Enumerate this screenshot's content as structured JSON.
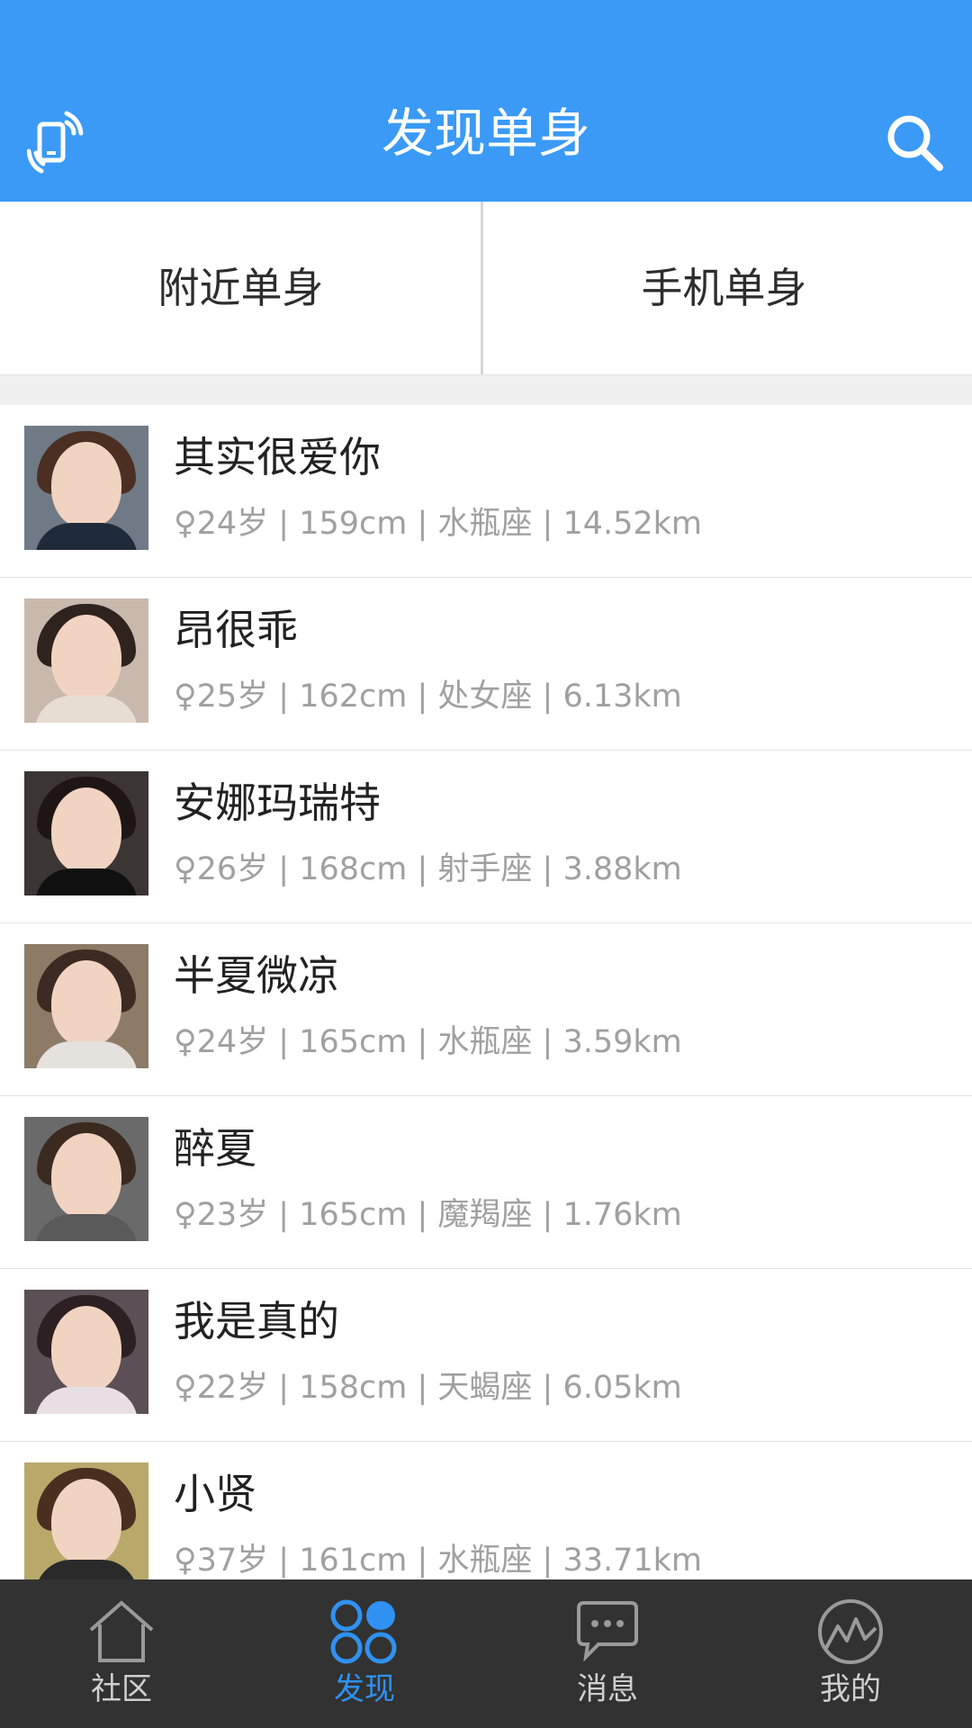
{
  "header": {
    "title": "发现单身",
    "left_icon": "phone-vibrate-icon",
    "right_icon": "search-icon",
    "color": "#3a9af6"
  },
  "segments": [
    {
      "label": "附近单身"
    },
    {
      "label": "手机单身"
    }
  ],
  "list": [
    {
      "name": "其实很爱你",
      "meta": "♀24岁 | 159cm | 水瓶座 | 14.52km"
    },
    {
      "name": "昂很乖",
      "meta": "♀25岁 | 162cm | 处女座 | 6.13km"
    },
    {
      "name": "安娜玛瑞特",
      "meta": "♀26岁 | 168cm | 射手座 | 3.88km"
    },
    {
      "name": "半夏微凉",
      "meta": "♀24岁 | 165cm | 水瓶座 | 3.59km"
    },
    {
      "name": "醉夏",
      "meta": "♀23岁 | 165cm | 魔羯座 | 1.76km"
    },
    {
      "name": "我是真的",
      "meta": "♀22岁 | 158cm | 天蝎座 | 6.05km"
    },
    {
      "name": "小贤",
      "meta": "♀37岁 | 161cm | 水瓶座 | 33.71km"
    }
  ],
  "tabbar": [
    {
      "label": "社区",
      "icon": "home-icon"
    },
    {
      "label": "发现",
      "icon": "discover-circles-icon",
      "active": true
    },
    {
      "label": "消息",
      "icon": "chat-bubble-icon"
    },
    {
      "label": "我的",
      "icon": "profile-mountain-icon"
    }
  ],
  "colors": {
    "accent": "#2f91f1",
    "tabbar_bg": "#323232",
    "meta_text": "#a0a0a0"
  }
}
